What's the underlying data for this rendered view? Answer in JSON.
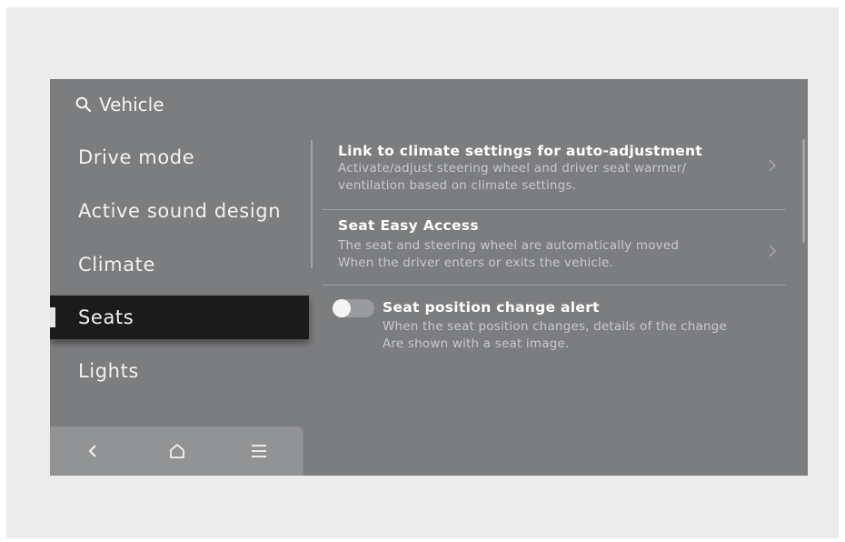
{
  "header": {
    "search_label": "Vehicle"
  },
  "menu": {
    "items": [
      {
        "label": "Drive mode"
      },
      {
        "label": "Active sound design"
      },
      {
        "label": "Climate"
      },
      {
        "label": "Seats",
        "selected": true
      },
      {
        "label": "Lights"
      }
    ]
  },
  "settings": [
    {
      "title": "Link to climate settings for auto-adjustment",
      "desc1": "Activate/adjust steering wheel and driver seat warmer/",
      "desc2": "ventilation based on climate settings."
    },
    {
      "title": "Seat Easy Access",
      "desc1": "The seat and steering wheel are automatically moved",
      "desc2": "When the driver enters or exits the vehicle."
    },
    {
      "title": "Seat position change alert",
      "desc1": "When the seat position changes, details of the change",
      "desc2": "Are shown with a seat image.",
      "toggle_on": false
    }
  ],
  "nav": {
    "back_icon": "back-icon",
    "home_icon": "home-icon",
    "menu_icon": "menu-icon"
  },
  "colors": {
    "screen_bg": "#7c7d7f",
    "selected_bg": "#1b1b1b",
    "frame_bg": "#ececec"
  }
}
